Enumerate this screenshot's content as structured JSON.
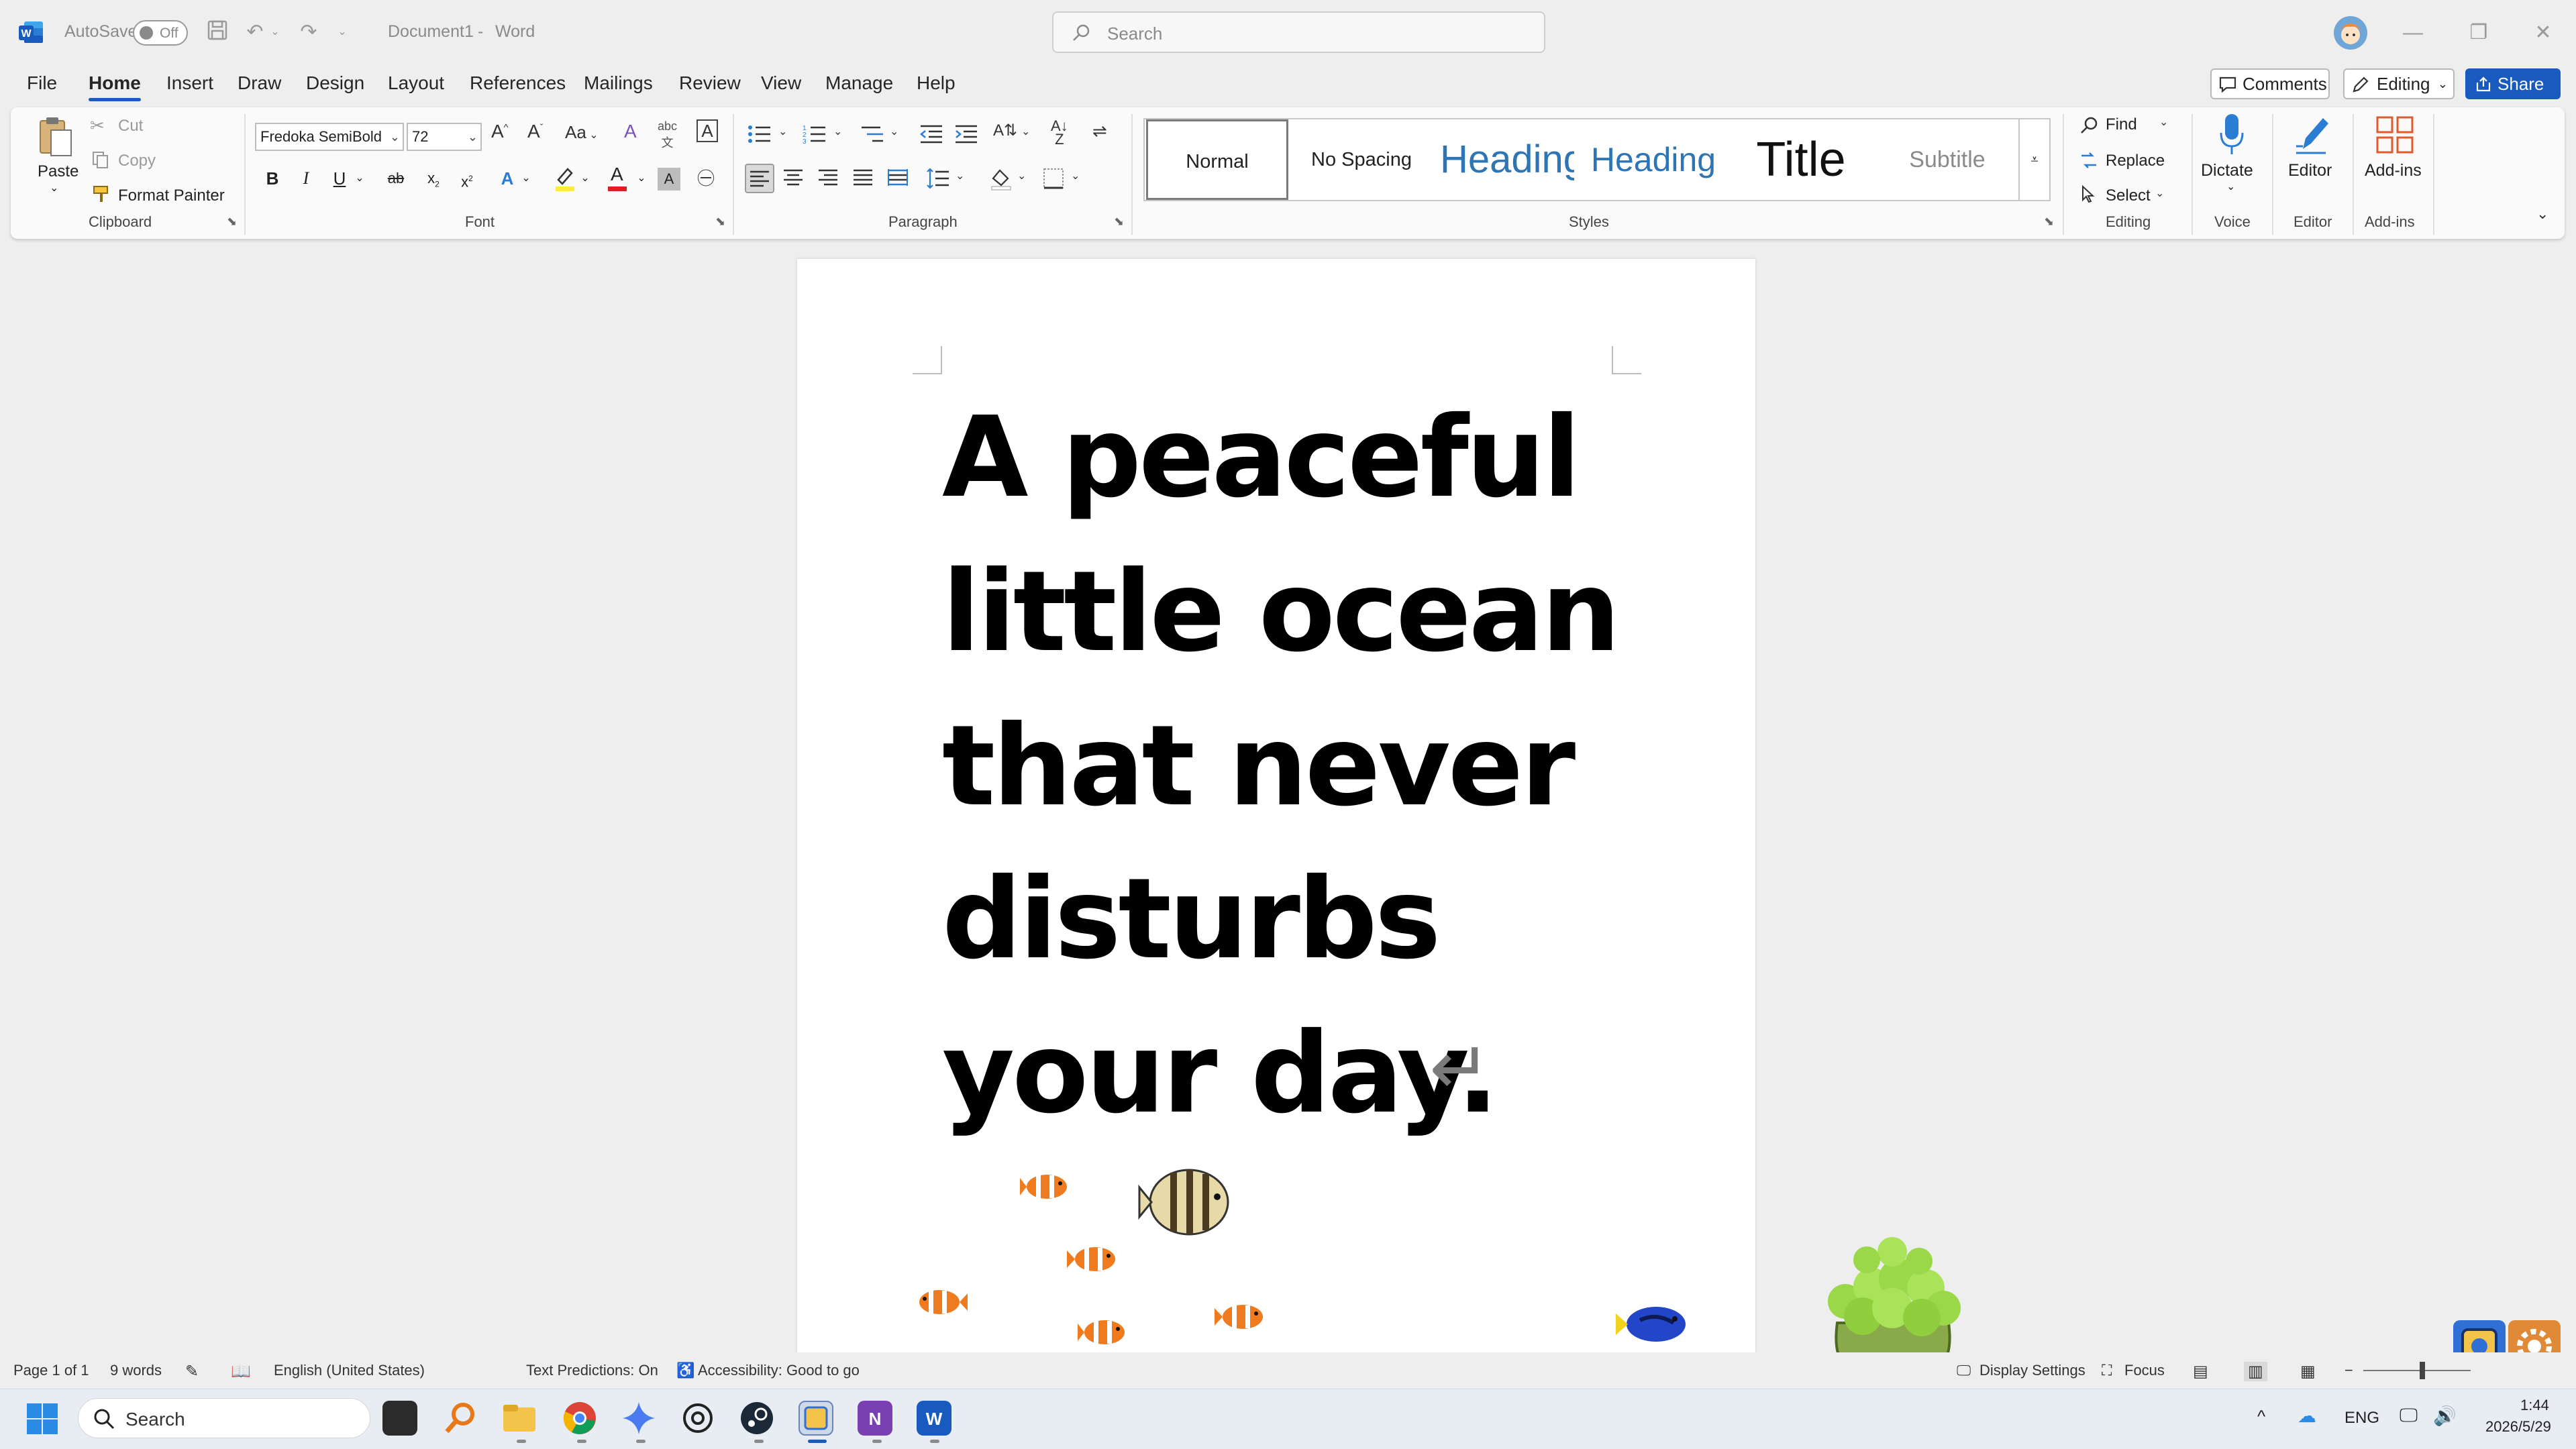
{
  "titlebar": {
    "autosave_label": "AutoSave",
    "autosave_state": "Off",
    "document_title": "Document1",
    "separator": "-",
    "app_name": "Word",
    "search_placeholder": "Search"
  },
  "menu": {
    "tabs": [
      "File",
      "Home",
      "Insert",
      "Draw",
      "Design",
      "Layout",
      "References",
      "Mailings",
      "Review",
      "View",
      "Manage",
      "Help"
    ],
    "active_tab": "Home",
    "comments_label": "Comments",
    "editing_label": "Editing",
    "share_label": "Share"
  },
  "ribbon": {
    "clipboard": {
      "paste": "Paste",
      "cut": "Cut",
      "copy": "Copy",
      "format_painter": "Format Painter",
      "group": "Clipboard"
    },
    "font": {
      "font_name": "Fredoka SemiBold",
      "font_size": "72",
      "change_case": "Aa",
      "bold": "B",
      "italic": "I",
      "underline": "U",
      "strikethrough": "ab",
      "subscript": "x",
      "superscript": "x",
      "group": "Font"
    },
    "paragraph": {
      "group": "Paragraph"
    },
    "styles": {
      "items": [
        "Normal",
        "No Spacing",
        "Heading",
        "Heading",
        "Title",
        "Subtitle"
      ],
      "group": "Styles"
    },
    "editing": {
      "find": "Find",
      "replace": "Replace",
      "select": "Select",
      "group": "Editing"
    },
    "voice": {
      "dictate": "Dictate",
      "group": "Voice"
    },
    "editor": {
      "editor": "Editor",
      "group": "Editor"
    },
    "addins": {
      "addins": "Add-ins",
      "group": "Add-ins"
    }
  },
  "document": {
    "lines": [
      "A peaceful",
      "little ocean",
      "that never",
      "disturbs",
      "your day."
    ],
    "paragraph_mark": "↵"
  },
  "statusbar": {
    "page": "Page 1 of 1",
    "words": "9 words",
    "language": "English (United States)",
    "text_predictions": "Text Predictions: On",
    "accessibility": "Accessibility: Good to go",
    "display_settings": "Display Settings",
    "focus": "Focus"
  },
  "taskbar": {
    "search_label": "Search",
    "language": "ENG",
    "time": "1:44",
    "date": "2026/5/29"
  },
  "colors": {
    "accent": "#185abd",
    "word_blue": "#2b579a",
    "highlight": "#ffeb3b",
    "font_color": "#e31b23"
  }
}
